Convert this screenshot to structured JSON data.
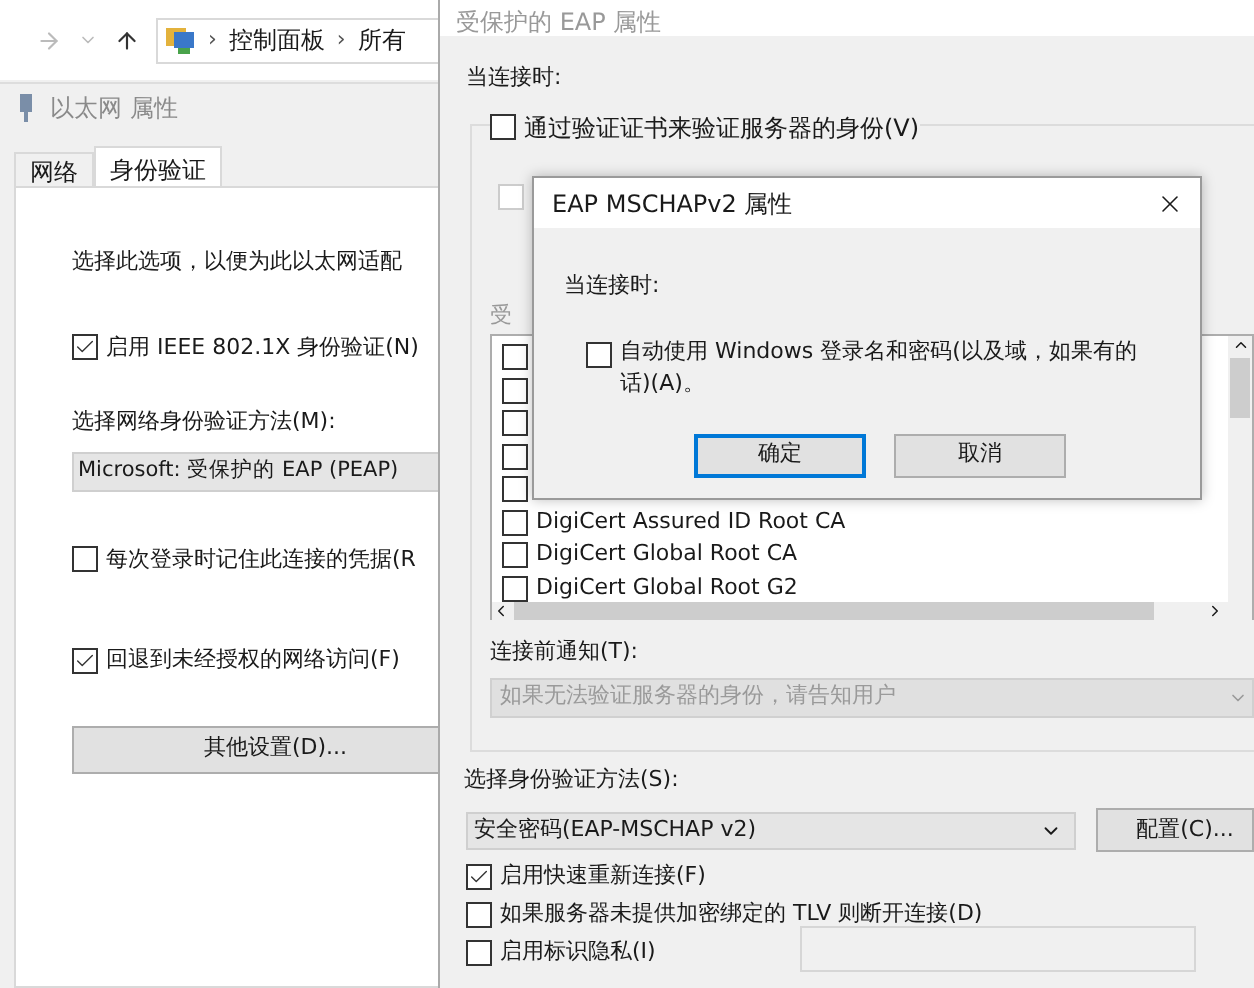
{
  "explorer": {
    "path": [
      "控制面板",
      "所有"
    ],
    "separator": "›"
  },
  "ethernet_window": {
    "title": "以太网 属性",
    "tabs": [
      {
        "label": "网络",
        "selected": false
      },
      {
        "label": "身份验证",
        "selected": true
      }
    ],
    "description": "选择此选项，以便为此以太网适配",
    "enable_option": {
      "label": "启用 IEEE 802.1X 身份验证(N)",
      "checked": true
    },
    "method_label": "选择网络身份验证方法(M):",
    "method_value": "Microsoft: 受保护的 EAP (PEAP)",
    "remember_option": {
      "label": "每次登录时记住此连接的凭据(R",
      "checked": false
    },
    "fallback_option": {
      "label": "回退到未经授权的网络访问(F)",
      "checked": true
    },
    "settings_button": "其他设置(D)..."
  },
  "peap_window": {
    "title": "受保护的 EAP 属性",
    "connect_label": "当连接时:",
    "verify_option": {
      "label": "通过验证证书来验证服务器的身份(V)",
      "checked": false
    },
    "covered_option": {
      "checked": false,
      "disabled": true
    },
    "ca_label": "受",
    "certificates": [
      {
        "checked": false
      },
      {
        "checked": false
      },
      {
        "checked": false
      },
      {
        "checked": false
      },
      {
        "checked": false
      },
      {
        "label": "DigiCert Assured ID Root CA",
        "checked": false
      },
      {
        "label": "DigiCert Global Root CA",
        "checked": false
      },
      {
        "label": "DigiCert Global Root G2",
        "checked": false
      }
    ],
    "notify_label": "连接前通知(T):",
    "notify_value": "如果无法验证服务器的身份，请告知用户",
    "method_label": "选择身份验证方法(S):",
    "method_value": "安全密码(EAP-MSCHAP v2)",
    "configure_button": "配置(C)...",
    "options": [
      {
        "label": "启用快速重新连接(F)",
        "checked": true
      },
      {
        "label": "如果服务器未提供加密绑定的 TLV 则断开连接(D)",
        "checked": false
      },
      {
        "label": "启用标识隐私(I)",
        "checked": false
      }
    ]
  },
  "dialog": {
    "title": "EAP MSCHAPv2 属性",
    "connect_label": "当连接时:",
    "auto_option": {
      "label": "自动使用 Windows 登录名和密码(以及域，如果有的话)(A)。",
      "checked": false
    },
    "buttons": [
      {
        "label": "确定",
        "selected": true
      },
      {
        "label": "取消",
        "selected": false
      }
    ]
  }
}
